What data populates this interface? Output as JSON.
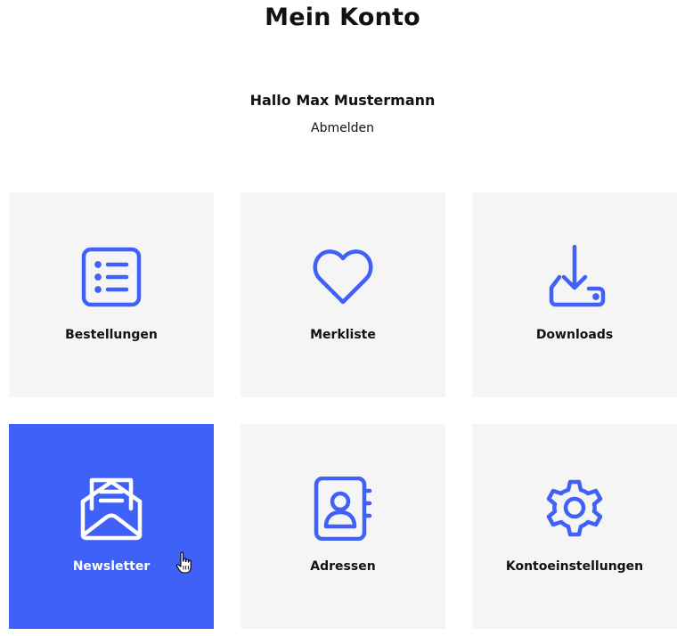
{
  "page": {
    "title": "Mein Konto",
    "greeting": "Hallo Max Mustermann",
    "logout_label": "Abmelden"
  },
  "colors": {
    "accent": "#4061f7",
    "tile_background": "#f5f5f5",
    "text": "#111111"
  },
  "tiles": [
    {
      "label": "Bestellungen",
      "icon": "order-list-icon",
      "active": false
    },
    {
      "label": "Merkliste",
      "icon": "heart-icon",
      "active": false
    },
    {
      "label": "Downloads",
      "icon": "download-icon",
      "active": false
    },
    {
      "label": "Newsletter",
      "icon": "envelope-letter-icon",
      "active": true
    },
    {
      "label": "Adressen",
      "icon": "address-book-icon",
      "active": false
    },
    {
      "label": "Kontoeinstellungen",
      "icon": "gear-icon",
      "active": false
    }
  ]
}
